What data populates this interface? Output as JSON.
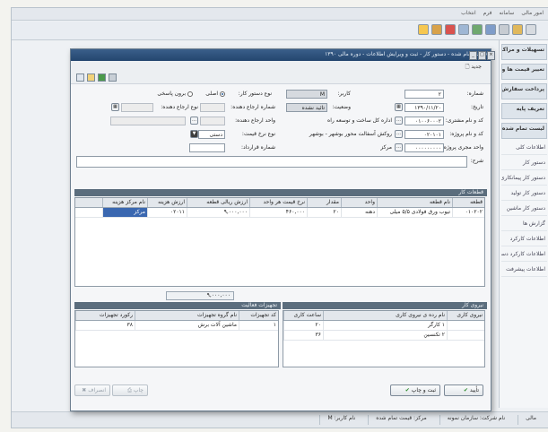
{
  "app": {
    "menu": [
      "امور مالی",
      "سامانه",
      "فرم",
      "انتخاب"
    ],
    "sidebar_items": [
      "تسهیلات و مراکز",
      "تغییر قیمت ها و ...",
      "پرداخت سفارش",
      "تعریف پایه",
      "لیست تمام شده",
      "اطلاعات کلی",
      "دستور کار",
      "دستور کار پیمانکاری",
      "دستور کار تولید",
      "دستور کار ماشین",
      "گزارش ها",
      "اطلاعات کارکرد",
      "اطلاعات کارکرد دستی",
      "اطلاعات پیشرفت"
    ],
    "status": [
      "مالی",
      "نام شرکت: سازمان نمونه",
      "مرکز: قیمت تمام شده",
      "نام کاربر: M"
    ]
  },
  "dialog": {
    "title": "قیمت تمام شده - دستور کار - ثبت و ویرایش اطلاعات - دوره مالی ۱۳۹۰",
    "new_label": "جدید",
    "form": {
      "number_label": "شماره:",
      "number_value": "۲",
      "date_label": "تاریخ:",
      "date_value": "۱۳۹۰/۱۱/۲۰",
      "user_label": "کاربر:",
      "user_value": "M",
      "status_label": "وضعیت:",
      "status_value": "تائید نشده",
      "type_label": "نوع دستور کار:",
      "radio_main": "اصلی",
      "radio_sub": "برون پاسخی",
      "ref_num_label": "شماره ارجاع دهنده:",
      "ref_type_label": "نوع ارجاع دهنده:",
      "ref_unit_label": "واحد ارجاع دهنده:",
      "customer_code_label": "کد و نام مشتری:",
      "customer_code": "۰۱۰۰۶۰۰۰۲",
      "customer_name": "اداره کل ساخت و توسعه راه",
      "project_code_label": "کد و نام پروژه:",
      "project_code": "۰۲۰۱۰۱",
      "project_name": "روکش آسفالت محور بوشهر - بوشهر",
      "exec_unit_label": "واحد مجری پروژه:",
      "exec_unit_code": "۰۰۰۰۰۰۰۰۰",
      "exec_unit_name": "مرکز",
      "price_type_label": "نوع نرخ قیمت:",
      "price_type_value": "دستی",
      "contract_label": "شماره قرارداد:",
      "desc_label": "شرح:"
    },
    "items_section": "قطعات کار",
    "items_columns": [
      "قطعه",
      "نام قطعه",
      "واحد",
      "مقدار",
      "نرخ قیمت هر واحد",
      "ارزش ریالی قطعه",
      "ارزش هزینه",
      "نام مرکز هزینه"
    ],
    "items_rows": [
      [
        "۰۱۰۲۰۲",
        "تیوب ورق فولادی ۵/۵ میلی",
        "دهنه",
        "۲۰",
        "۴۶۰,۰۰۰",
        "۹,۰۰۰,۰۰۰",
        "۰۲۰۱۱",
        "مرکز"
      ]
    ],
    "items_total": "۹,۰۰۰,۰۰۰",
    "labor_section": "نیروی کار",
    "labor_columns": [
      "نیروی کاری",
      "نام رده ی نیروی کاری",
      "ساعت کاری"
    ],
    "labor_rows": [
      [
        "",
        "۱ کارگر",
        "۲۰"
      ],
      [
        "",
        "۲ تکنسین",
        "۳۶"
      ]
    ],
    "equip_section": "تجهیزات فعالیت",
    "equip_columns": [
      "کد تجهیزات",
      "نام گروه تجهیزات",
      "رکورد تجهیزات"
    ],
    "equip_rows": [
      [
        "۱",
        "ماشین آلات برش",
        "۳۸"
      ]
    ],
    "buttons": {
      "confirm": "تأیید",
      "save_print": "ثبت و چاپ",
      "cancel": "انصراف",
      "print": "چاپ"
    }
  }
}
